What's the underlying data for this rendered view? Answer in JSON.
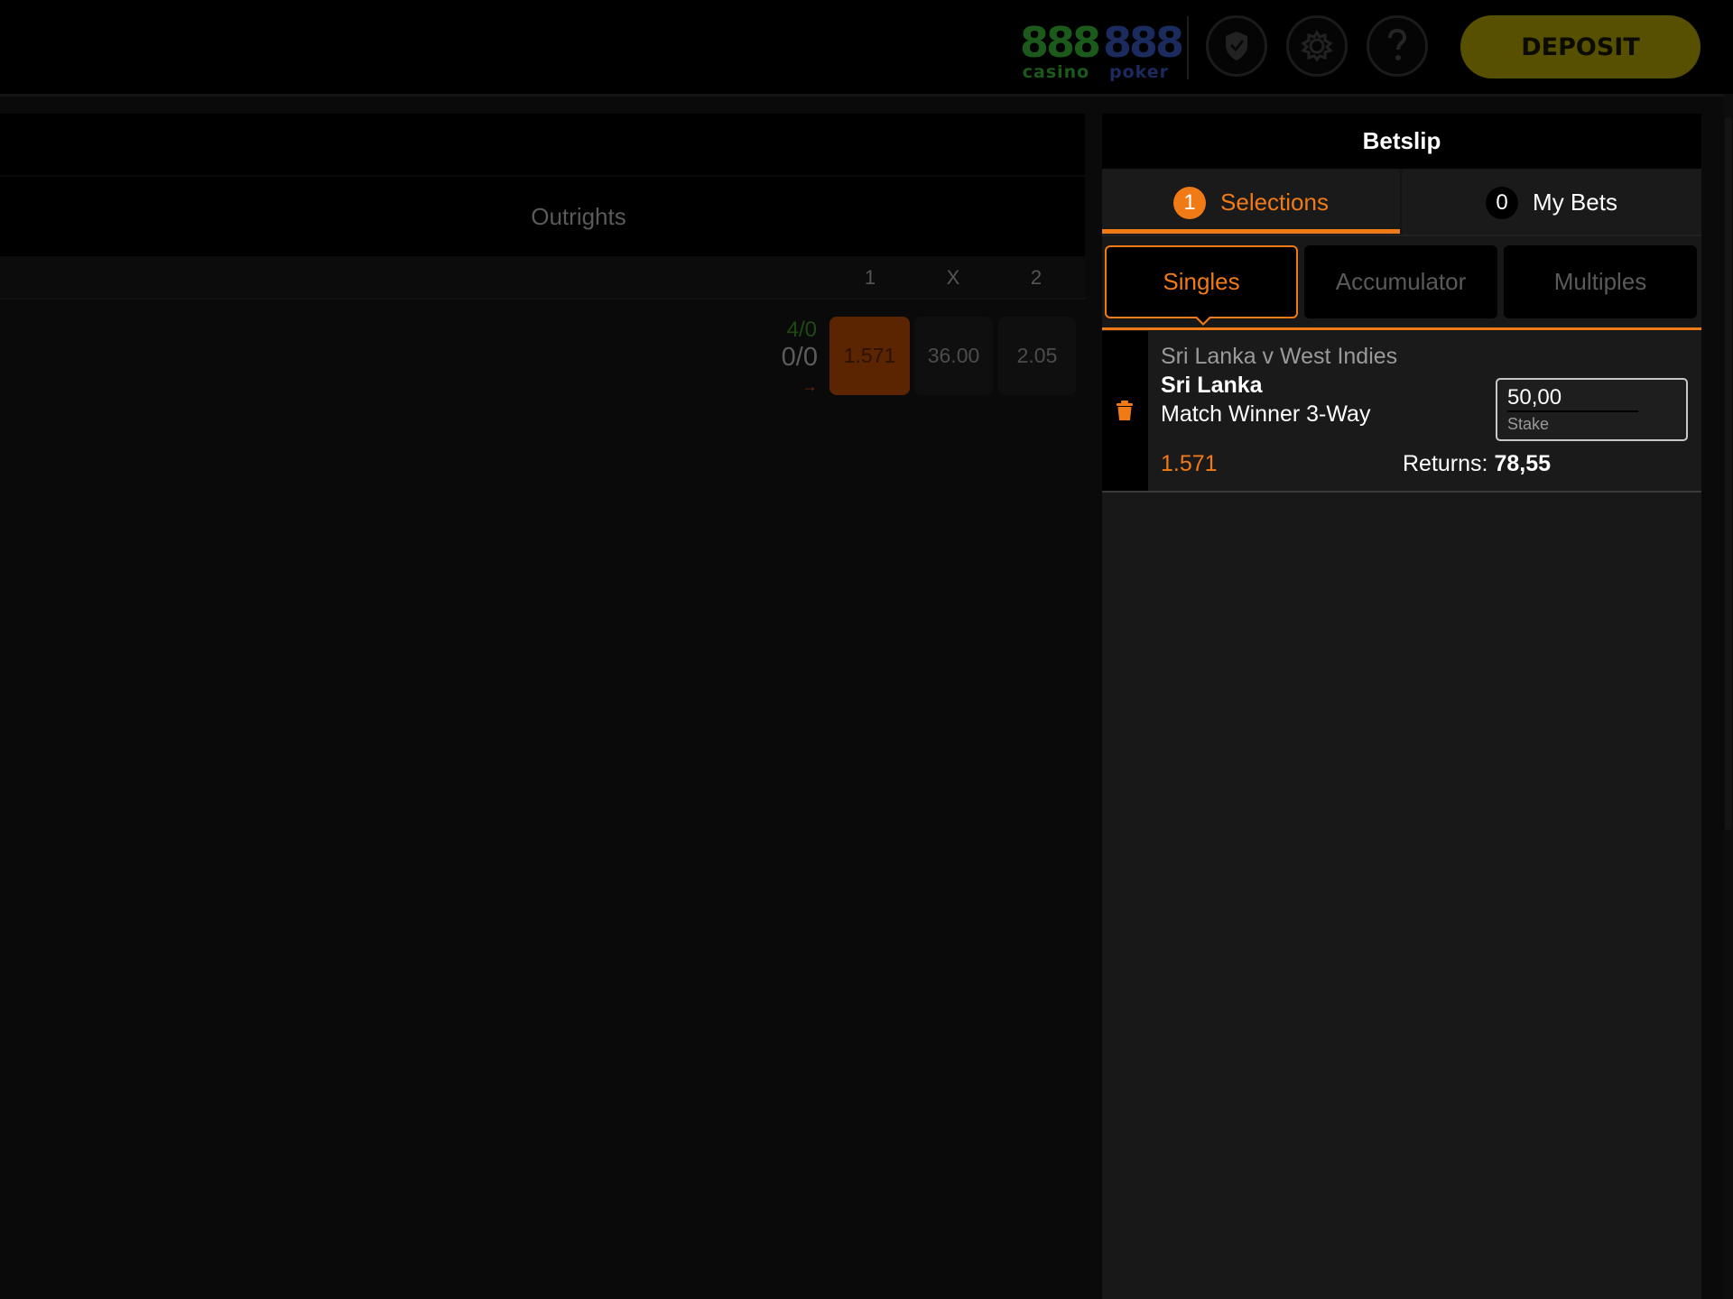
{
  "header": {
    "logos": [
      {
        "number": "888",
        "label": "casino",
        "color": "#1c5a1c"
      },
      {
        "number": "888",
        "label": "poker",
        "color": "#1b2b5e"
      }
    ],
    "icons": [
      "shield-check-icon",
      "gear-icon",
      "help-icon"
    ],
    "deposit_label": "DEPOSIT"
  },
  "main": {
    "section_label": "Outrights",
    "columns": [
      "1",
      "X",
      "2"
    ],
    "event_row": {
      "score_top": "4/0",
      "score_main": "0/0",
      "odds": [
        {
          "value": "1.571",
          "selected": true
        },
        {
          "value": "36.00",
          "selected": false
        },
        {
          "value": "2.05",
          "selected": false
        }
      ]
    }
  },
  "betslip": {
    "title": "Betslip",
    "tabs": [
      {
        "count": "1",
        "label": "Selections",
        "active": true
      },
      {
        "count": "0",
        "label": "My Bets",
        "active": false
      }
    ],
    "bet_types": [
      {
        "label": "Singles",
        "active": true
      },
      {
        "label": "Accumulator",
        "active": false
      },
      {
        "label": "Multiples",
        "active": false
      }
    ],
    "selection": {
      "event": "Sri Lanka v West Indies",
      "pick": "Sri Lanka",
      "market": "Match Winner 3-Way",
      "odds": "1.571",
      "stake_value": "50,00",
      "stake_label": "Stake",
      "returns_label": "Returns:",
      "returns_value": "78,55"
    }
  },
  "colors": {
    "accent": "#f07a16",
    "deposit": "#575000",
    "panel": "#181818"
  }
}
